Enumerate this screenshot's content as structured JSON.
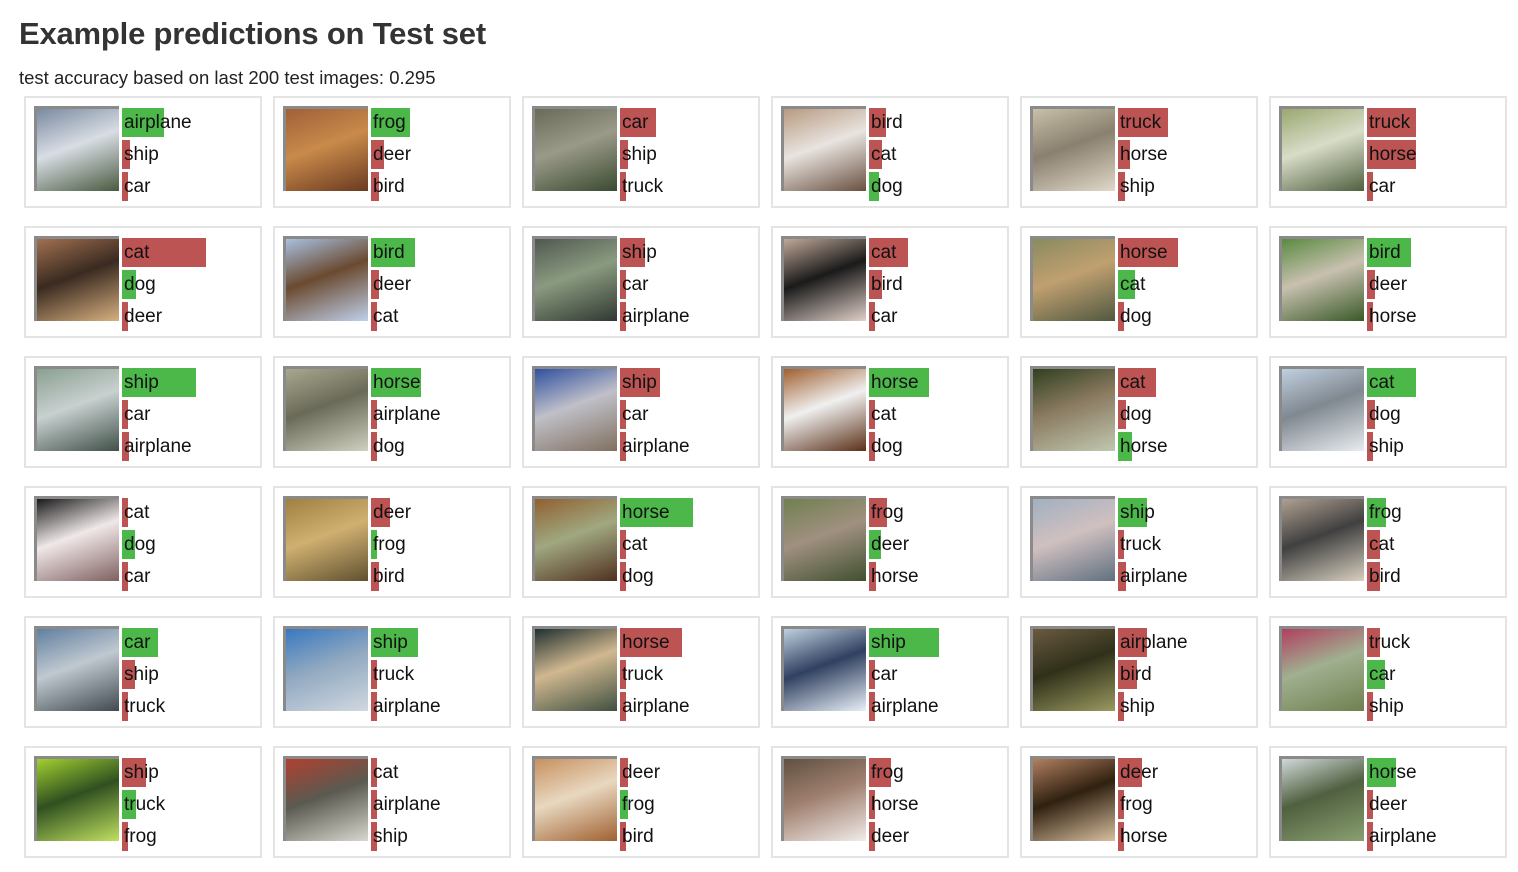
{
  "page": {
    "title": "Example predictions on Test set",
    "subtitle": "test accuracy based on last 200 test images: 0.295"
  },
  "colors": {
    "correct": "#4cb84a",
    "wrong": "#bd5454"
  },
  "cards": [
    {
      "image": "airplane-on-runway",
      "colors": [
        "#7a8aa0",
        "#d8dde4",
        "#4a5a40"
      ],
      "predictions": [
        {
          "label": "airplane",
          "prob": 0.5,
          "correct": true
        },
        {
          "label": "ship",
          "prob": 0.09,
          "correct": false
        },
        {
          "label": "car",
          "prob": 0.05,
          "correct": false
        }
      ]
    },
    {
      "image": "frog-on-leaves",
      "colors": [
        "#a0603a",
        "#c98a4a",
        "#6a3a20"
      ],
      "predictions": [
        {
          "label": "frog",
          "prob": 0.46,
          "correct": true
        },
        {
          "label": "deer",
          "prob": 0.15,
          "correct": false
        },
        {
          "label": "bird",
          "prob": 0.1,
          "correct": false
        }
      ]
    },
    {
      "image": "cat-in-grass",
      "colors": [
        "#6a6a5a",
        "#9a9a88",
        "#3a4a30"
      ],
      "predictions": [
        {
          "label": "car",
          "prob": 0.43,
          "correct": false
        },
        {
          "label": "ship",
          "prob": 0.09,
          "correct": false
        },
        {
          "label": "truck",
          "prob": 0.07,
          "correct": false
        }
      ]
    },
    {
      "image": "dog-lying",
      "colors": [
        "#b89a80",
        "#e8e4e0",
        "#6a5040"
      ],
      "predictions": [
        {
          "label": "bird",
          "prob": 0.2,
          "correct": false
        },
        {
          "label": "cat",
          "prob": 0.15,
          "correct": false
        },
        {
          "label": "dog",
          "prob": 0.12,
          "correct": true
        }
      ]
    },
    {
      "image": "car-on-road",
      "colors": [
        "#c8c0a8",
        "#8a8070",
        "#e0d8c8"
      ],
      "predictions": [
        {
          "label": "truck",
          "prob": 0.59,
          "correct": false
        },
        {
          "label": "horse",
          "prob": 0.14,
          "correct": false
        },
        {
          "label": "ship",
          "prob": 0.08,
          "correct": false
        }
      ]
    },
    {
      "image": "ship-hull",
      "colors": [
        "#9aa870",
        "#d8dcc8",
        "#506040"
      ],
      "predictions": [
        {
          "label": "truck",
          "prob": 0.58,
          "correct": false
        },
        {
          "label": "horse",
          "prob": 0.58,
          "correct": false
        },
        {
          "label": "car",
          "prob": 0.02,
          "correct": false
        }
      ]
    },
    {
      "image": "dog-sitting",
      "colors": [
        "#a07050",
        "#3a2a20",
        "#d8b080"
      ],
      "predictions": [
        {
          "label": "cat",
          "prob": 1.0,
          "correct": false
        },
        {
          "label": "dog",
          "prob": 0.17,
          "correct": true
        },
        {
          "label": "deer",
          "prob": 0.04,
          "correct": false
        }
      ]
    },
    {
      "image": "bird-flying",
      "colors": [
        "#a8c0e0",
        "#6a4a30",
        "#c0d0ea"
      ],
      "predictions": [
        {
          "label": "bird",
          "prob": 0.52,
          "correct": true
        },
        {
          "label": "deer",
          "prob": 0.1,
          "correct": false
        },
        {
          "label": "cat",
          "prob": 0.04,
          "correct": false
        }
      ]
    },
    {
      "image": "frog-in-foliage",
      "colors": [
        "#505850",
        "#8a9a80",
        "#303830"
      ],
      "predictions": [
        {
          "label": "ship",
          "prob": 0.3,
          "correct": false
        },
        {
          "label": "car",
          "prob": 0.07,
          "correct": false
        },
        {
          "label": "airplane",
          "prob": 0.05,
          "correct": false
        }
      ]
    },
    {
      "image": "dog-black",
      "colors": [
        "#c0a898",
        "#1a1a1a",
        "#e0d0c8"
      ],
      "predictions": [
        {
          "label": "cat",
          "prob": 0.46,
          "correct": false
        },
        {
          "label": "bird",
          "prob": 0.15,
          "correct": false
        },
        {
          "label": "car",
          "prob": 0.04,
          "correct": false
        }
      ]
    },
    {
      "image": "deer-in-field",
      "colors": [
        "#8a8a60",
        "#c0a070",
        "#505840"
      ],
      "predictions": [
        {
          "label": "horse",
          "prob": 0.71,
          "correct": false
        },
        {
          "label": "cat",
          "prob": 0.2,
          "correct": true
        },
        {
          "label": "dog",
          "prob": 0.05,
          "correct": false
        }
      ]
    },
    {
      "image": "bird-on-branch",
      "colors": [
        "#5a8a40",
        "#c8c0b0",
        "#3a5a28"
      ],
      "predictions": [
        {
          "label": "bird",
          "prob": 0.52,
          "correct": true
        },
        {
          "label": "deer",
          "prob": 0.1,
          "correct": false
        },
        {
          "label": "horse",
          "prob": 0.07,
          "correct": false
        }
      ]
    },
    {
      "image": "boat-on-lake",
      "colors": [
        "#8aa090",
        "#c8d0d0",
        "#405048"
      ],
      "predictions": [
        {
          "label": "ship",
          "prob": 0.88,
          "correct": true
        },
        {
          "label": "car",
          "prob": 0.03,
          "correct": false
        },
        {
          "label": "airplane",
          "prob": 0.08,
          "correct": false
        }
      ]
    },
    {
      "image": "stone-statue",
      "colors": [
        "#a8a890",
        "#6a6a58",
        "#d0d0c0"
      ],
      "predictions": [
        {
          "label": "horse",
          "prob": 0.6,
          "correct": true
        },
        {
          "label": "airplane",
          "prob": 0.05,
          "correct": false
        },
        {
          "label": "dog",
          "prob": 0.04,
          "correct": false
        }
      ]
    },
    {
      "image": "blue-truck",
      "colors": [
        "#3050a0",
        "#c0c0c8",
        "#807060"
      ],
      "predictions": [
        {
          "label": "ship",
          "prob": 0.48,
          "correct": false
        },
        {
          "label": "car",
          "prob": 0.07,
          "correct": false
        },
        {
          "label": "airplane",
          "prob": 0.05,
          "correct": false
        }
      ]
    },
    {
      "image": "brown-horse",
      "colors": [
        "#a06030",
        "#f0f0f0",
        "#5a3018"
      ],
      "predictions": [
        {
          "label": "horse",
          "prob": 0.72,
          "correct": true
        },
        {
          "label": "cat",
          "prob": 0.04,
          "correct": false
        },
        {
          "label": "dog",
          "prob": 0.04,
          "correct": false
        }
      ]
    },
    {
      "image": "horse-under-tree",
      "colors": [
        "#304020",
        "#8a7a60",
        "#c0c8b0"
      ],
      "predictions": [
        {
          "label": "cat",
          "prob": 0.45,
          "correct": false
        },
        {
          "label": "dog",
          "prob": 0.1,
          "correct": false
        },
        {
          "label": "horse",
          "prob": 0.17,
          "correct": true
        }
      ]
    },
    {
      "image": "white-cat",
      "colors": [
        "#c0d0e0",
        "#808890",
        "#e8ecf0"
      ],
      "predictions": [
        {
          "label": "cat",
          "prob": 0.58,
          "correct": true
        },
        {
          "label": "dog",
          "prob": 0.09,
          "correct": false
        },
        {
          "label": "ship",
          "prob": 0.04,
          "correct": false
        }
      ]
    },
    {
      "image": "dog-white-black",
      "colors": [
        "#1a1a1a",
        "#f0e8e8",
        "#806060"
      ],
      "predictions": [
        {
          "label": "cat",
          "prob": 0.06,
          "correct": false
        },
        {
          "label": "dog",
          "prob": 0.15,
          "correct": true
        },
        {
          "label": "car",
          "prob": 0.03,
          "correct": false
        }
      ]
    },
    {
      "image": "frog-on-sand",
      "colors": [
        "#a08040",
        "#d0b070",
        "#605030"
      ],
      "predictions": [
        {
          "label": "deer",
          "prob": 0.23,
          "correct": false
        },
        {
          "label": "frog",
          "prob": 0.06,
          "correct": true
        },
        {
          "label": "bird",
          "prob": 0.1,
          "correct": false
        }
      ]
    },
    {
      "image": "horse-standing",
      "colors": [
        "#906030",
        "#a0a880",
        "#503020"
      ],
      "predictions": [
        {
          "label": "horse",
          "prob": 0.87,
          "correct": true
        },
        {
          "label": "cat",
          "prob": 0.04,
          "correct": false
        },
        {
          "label": "dog",
          "prob": 0.04,
          "correct": false
        }
      ]
    },
    {
      "image": "deer-grazing",
      "colors": [
        "#708050",
        "#a09080",
        "#405030"
      ],
      "predictions": [
        {
          "label": "frog",
          "prob": 0.22,
          "correct": false
        },
        {
          "label": "deer",
          "prob": 0.14,
          "correct": true
        },
        {
          "label": "horse",
          "prob": 0.08,
          "correct": false
        }
      ]
    },
    {
      "image": "warship",
      "colors": [
        "#a0b0c0",
        "#d0c0c0",
        "#607080"
      ],
      "predictions": [
        {
          "label": "ship",
          "prob": 0.34,
          "correct": true
        },
        {
          "label": "truck",
          "prob": 0.04,
          "correct": false
        },
        {
          "label": "airplane",
          "prob": 0.1,
          "correct": false
        }
      ]
    },
    {
      "image": "frog-on-floor",
      "colors": [
        "#b0a090",
        "#404040",
        "#d8d0c0"
      ],
      "predictions": [
        {
          "label": "frog",
          "prob": 0.23,
          "correct": true
        },
        {
          "label": "cat",
          "prob": 0.15,
          "correct": false
        },
        {
          "label": "bird",
          "prob": 0.15,
          "correct": false
        }
      ]
    },
    {
      "image": "pickup-truck",
      "colors": [
        "#6080a0",
        "#c0c8d0",
        "#404850"
      ],
      "predictions": [
        {
          "label": "car",
          "prob": 0.43,
          "correct": true
        },
        {
          "label": "ship",
          "prob": 0.15,
          "correct": false
        },
        {
          "label": "truck",
          "prob": 0.07,
          "correct": false
        }
      ]
    },
    {
      "image": "blue-boat",
      "colors": [
        "#3878c0",
        "#90a8c0",
        "#d0d8e0"
      ],
      "predictions": [
        {
          "label": "ship",
          "prob": 0.56,
          "correct": true
        },
        {
          "label": "truck",
          "prob": 0.04,
          "correct": false
        },
        {
          "label": "airplane",
          "prob": 0.04,
          "correct": false
        }
      ]
    },
    {
      "image": "siamese-cat",
      "colors": [
        "#203030",
        "#d0b890",
        "#405040"
      ],
      "predictions": [
        {
          "label": "horse",
          "prob": 0.74,
          "correct": false
        },
        {
          "label": "truck",
          "prob": 0.04,
          "correct": false
        },
        {
          "label": "airplane",
          "prob": 0.05,
          "correct": false
        }
      ]
    },
    {
      "image": "speedboat",
      "colors": [
        "#c0d0e0",
        "#304060",
        "#e8f0f8"
      ],
      "predictions": [
        {
          "label": "ship",
          "prob": 0.83,
          "correct": true
        },
        {
          "label": "car",
          "prob": 0.05,
          "correct": false
        },
        {
          "label": "airplane",
          "prob": 0.05,
          "correct": false
        }
      ]
    },
    {
      "image": "frog-on-rock",
      "colors": [
        "#6a5a40",
        "#30301a",
        "#9a9a60"
      ],
      "predictions": [
        {
          "label": "airplane",
          "prob": 0.35,
          "correct": false
        },
        {
          "label": "bird",
          "prob": 0.23,
          "correct": false
        },
        {
          "label": "ship",
          "prob": 0.07,
          "correct": false
        }
      ]
    },
    {
      "image": "red-car",
      "colors": [
        "#b04060",
        "#a0b090",
        "#708050"
      ],
      "predictions": [
        {
          "label": "truck",
          "prob": 0.16,
          "correct": false
        },
        {
          "label": "car",
          "prob": 0.21,
          "correct": true
        },
        {
          "label": "ship",
          "prob": 0.07,
          "correct": false
        }
      ]
    },
    {
      "image": "green-truck",
      "colors": [
        "#a0d030",
        "#305020",
        "#c0e060"
      ],
      "predictions": [
        {
          "label": "ship",
          "prob": 0.29,
          "correct": false
        },
        {
          "label": "truck",
          "prob": 0.17,
          "correct": true
        },
        {
          "label": "frog",
          "prob": 0.05,
          "correct": false
        }
      ]
    },
    {
      "image": "old-red-truck",
      "colors": [
        "#b04030",
        "#5a5a50",
        "#d8d8d0"
      ],
      "predictions": [
        {
          "label": "cat",
          "prob": 0.06,
          "correct": false
        },
        {
          "label": "airplane",
          "prob": 0.04,
          "correct": false
        },
        {
          "label": "ship",
          "prob": 0.06,
          "correct": false
        }
      ]
    },
    {
      "image": "frog-hands",
      "colors": [
        "#c89060",
        "#e8d8c0",
        "#a06030"
      ],
      "predictions": [
        {
          "label": "deer",
          "prob": 0.09,
          "correct": false
        },
        {
          "label": "frog",
          "prob": 0.09,
          "correct": true
        },
        {
          "label": "bird",
          "prob": 0.06,
          "correct": false
        }
      ]
    },
    {
      "image": "cat-in-basket",
      "colors": [
        "#605040",
        "#a08070",
        "#f0ece8"
      ],
      "predictions": [
        {
          "label": "frog",
          "prob": 0.26,
          "correct": false
        },
        {
          "label": "horse",
          "prob": 0.03,
          "correct": false
        },
        {
          "label": "deer",
          "prob": 0.05,
          "correct": false
        }
      ]
    },
    {
      "image": "dog-lying-floor",
      "colors": [
        "#b08060",
        "#302010",
        "#d8c0a0"
      ],
      "predictions": [
        {
          "label": "deer",
          "prob": 0.29,
          "correct": false
        },
        {
          "label": "frog",
          "prob": 0.05,
          "correct": false
        },
        {
          "label": "horse",
          "prob": 0.04,
          "correct": false
        }
      ]
    },
    {
      "image": "white-horse",
      "colors": [
        "#d0d8d8",
        "#506040",
        "#8aa070"
      ],
      "predictions": [
        {
          "label": "horse",
          "prob": 0.35,
          "correct": true
        },
        {
          "label": "deer",
          "prob": 0.04,
          "correct": false
        },
        {
          "label": "airplane",
          "prob": 0.04,
          "correct": false
        }
      ]
    }
  ]
}
